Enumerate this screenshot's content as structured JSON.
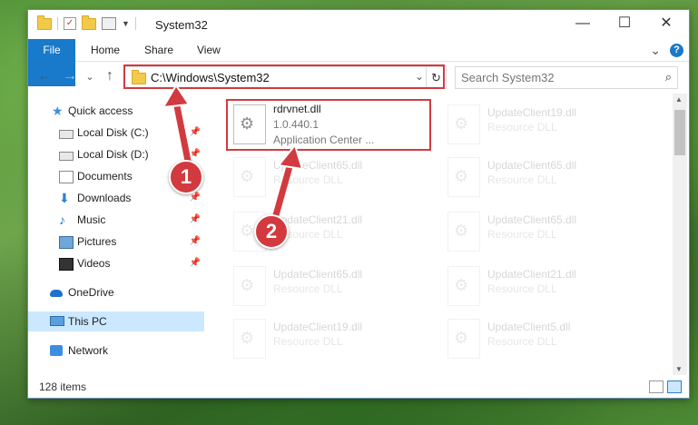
{
  "window": {
    "title": "System32",
    "controls": {
      "minimize": "—",
      "maximize": "☐",
      "close": "✕"
    }
  },
  "ribbon": {
    "tabs": [
      "File",
      "Home",
      "Share",
      "View"
    ],
    "expand": "⌄",
    "help": "?"
  },
  "nav": {
    "back": "←",
    "forward": "→",
    "recent": "⌄",
    "up": "↑",
    "address": "C:\\Windows\\System32",
    "refresh": "↻",
    "search_placeholder": "Search System32"
  },
  "sidebar": {
    "items": [
      {
        "label": "Quick access",
        "icon": "star-icon",
        "pinned": false
      },
      {
        "label": "Local Disk (C:)",
        "icon": "drive-icon",
        "pinned": true
      },
      {
        "label": "Local Disk (D:)",
        "icon": "drive-icon",
        "pinned": true
      },
      {
        "label": "Documents",
        "icon": "documents-icon",
        "pinned": true
      },
      {
        "label": "Downloads",
        "icon": "download-icon",
        "pinned": true
      },
      {
        "label": "Music",
        "icon": "music-icon",
        "pinned": true
      },
      {
        "label": "Pictures",
        "icon": "pictures-icon",
        "pinned": true
      },
      {
        "label": "Videos",
        "icon": "videos-icon",
        "pinned": true
      },
      {
        "label": "OneDrive",
        "icon": "cloud-icon",
        "pinned": false
      },
      {
        "label": "This PC",
        "icon": "computer-icon",
        "pinned": false,
        "selected": true
      },
      {
        "label": "Network",
        "icon": "network-icon",
        "pinned": false
      }
    ],
    "pin_glyph": "📌"
  },
  "files": [
    {
      "name": "rdrvnet.dll",
      "line1": "1.0.440.1",
      "line2": "Application Center ...",
      "highlighted": true
    },
    {
      "name": "UpdateClient19.dll",
      "line1": "Resource DLL"
    },
    {
      "name": "UpdateClient65.dll",
      "line1": "Resource DLL"
    },
    {
      "name": "UpdateClient65.dll",
      "line1": "Resource DLL"
    },
    {
      "name": "UpdateClient21.dll",
      "line1": "Resource DLL"
    },
    {
      "name": "UpdateClient65.dll",
      "line1": "Resource DLL"
    },
    {
      "name": "UpdateClient65.dll",
      "line1": "Resource DLL"
    },
    {
      "name": "UpdateClient21.dll",
      "line1": "Resource DLL"
    },
    {
      "name": "UpdateClient19.dll",
      "line1": "Resource DLL"
    },
    {
      "name": "UpdateClient5.dll",
      "line1": "Resource DLL"
    }
  ],
  "status": {
    "item_count": "128 items"
  },
  "callouts": [
    {
      "number": "1"
    },
    {
      "number": "2"
    }
  ],
  "colors": {
    "accent": "#1979ca",
    "highlight": "#d23a3f",
    "selection": "#cce8ff"
  }
}
